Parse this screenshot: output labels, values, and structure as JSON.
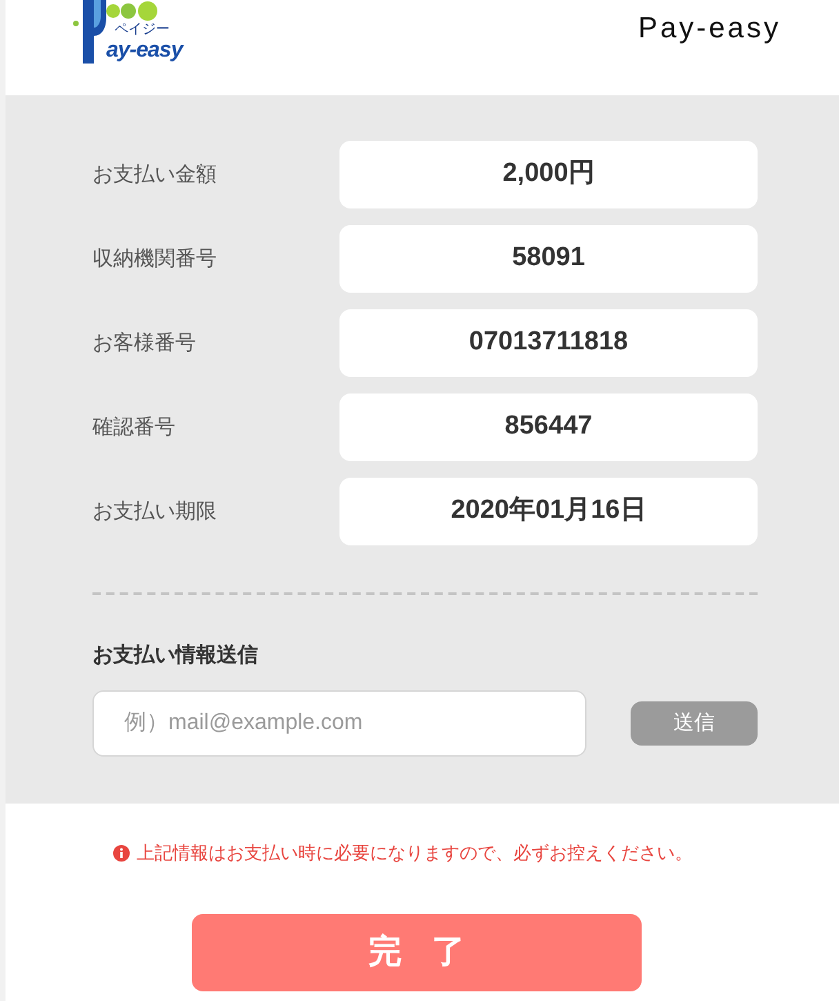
{
  "header": {
    "logo": {
      "reading": "ペイジー",
      "wordmark": "ay-easy"
    },
    "title": "Pay-easy"
  },
  "details": [
    {
      "label": "お支払い金額",
      "value": "2,000円"
    },
    {
      "label": "収納機関番号",
      "value": "58091"
    },
    {
      "label": "お客様番号",
      "value": "07013711818"
    },
    {
      "label": "確認番号",
      "value": "856447"
    },
    {
      "label": "お支払い期限",
      "value": "2020年01月16日"
    }
  ],
  "send_section": {
    "heading": "お支払い情報送信",
    "email_field": {
      "placeholder": "例）mail@example.com"
    },
    "send_button": {
      "label": "送信",
      "disabled": true
    }
  },
  "notice": "上記情報はお支払い時に必要になりますので、必ずお控えください。",
  "done_button": {
    "label": "完了"
  }
}
